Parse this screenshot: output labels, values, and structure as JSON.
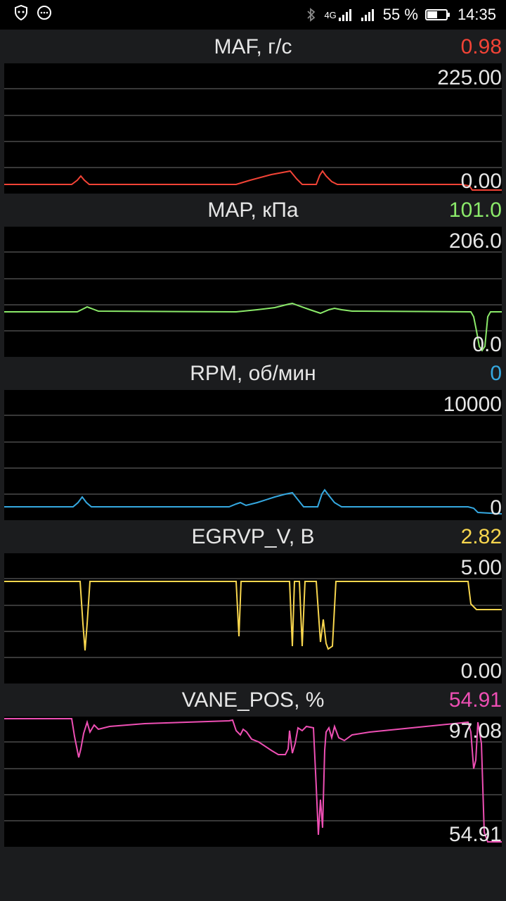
{
  "status_bar": {
    "left_icons": [
      "shield-icon",
      "chat-bubble-icon"
    ],
    "bluetooth_icon": "bluetooth-icon",
    "network_label": "4G",
    "battery_text": "55 %",
    "battery_level": 0.55,
    "time": "14:35"
  },
  "panels": [
    {
      "title": "MAF, г/с",
      "value": "0.98",
      "max_label": "225.00",
      "min_label": "0.00",
      "color": "#f24336"
    },
    {
      "title": "MAP, кПа",
      "value": "101.0",
      "max_label": "206.0",
      "min_label": "0.0",
      "color": "#8bea6a"
    },
    {
      "title": "RPM, об/мин",
      "value": "0",
      "max_label": "10000",
      "min_label": "0",
      "color": "#35a8e0"
    },
    {
      "title": "EGRVP_V, B",
      "value": "2.82",
      "max_label": "5.00",
      "min_label": "0.00",
      "color": "#f8d64e"
    },
    {
      "title": "VANE_POS, %",
      "value": "54.91",
      "max_label": "97.08",
      "min_label": "54.91",
      "color": "#ee4fb4"
    }
  ]
}
